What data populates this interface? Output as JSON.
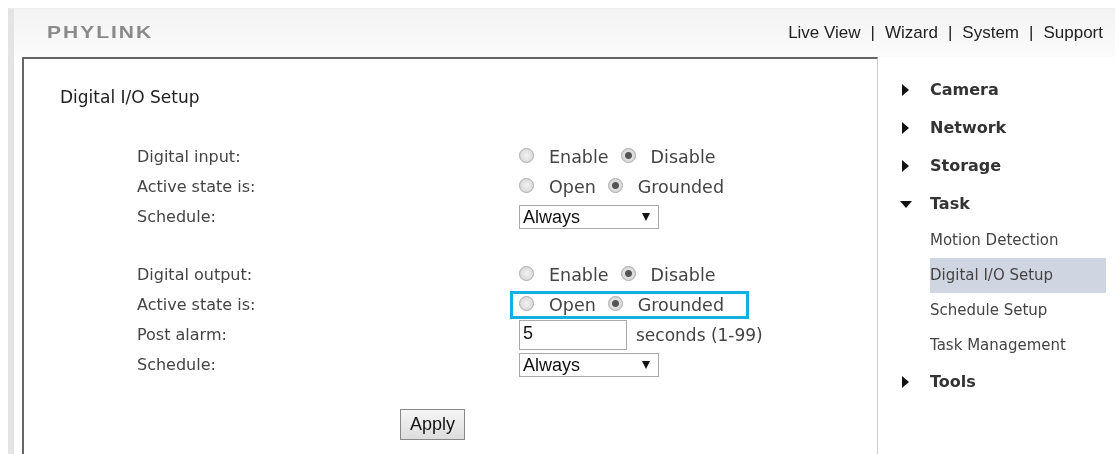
{
  "header": {
    "logo": "PHYLINK",
    "separator": "|",
    "nav": [
      {
        "label": "Live View"
      },
      {
        "label": "Wizard"
      },
      {
        "label": "System"
      },
      {
        "label": "Support"
      }
    ]
  },
  "panel": {
    "title": "Digital I/O Setup",
    "groups": [
      {
        "rows": [
          {
            "kind": "radio",
            "label": "Digital input:",
            "highlighted": false,
            "options": [
              {
                "label": "Enable",
                "selected": false
              },
              {
                "label": "Disable",
                "selected": true
              }
            ]
          },
          {
            "kind": "radio",
            "label": "Active state is:",
            "highlighted": false,
            "options": [
              {
                "label": "Open",
                "selected": false
              },
              {
                "label": "Grounded",
                "selected": true
              }
            ]
          },
          {
            "kind": "select",
            "label": "Schedule:",
            "value": "Always"
          }
        ]
      },
      {
        "rows": [
          {
            "kind": "radio",
            "label": "Digital output:",
            "highlighted": false,
            "options": [
              {
                "label": "Enable",
                "selected": false
              },
              {
                "label": "Disable",
                "selected": true
              }
            ]
          },
          {
            "kind": "radio",
            "label": "Active state is:",
            "highlighted": true,
            "options": [
              {
                "label": "Open",
                "selected": false
              },
              {
                "label": "Grounded",
                "selected": true
              }
            ]
          },
          {
            "kind": "number",
            "label": "Post alarm:",
            "value": "5",
            "suffix": "seconds (1-99)"
          },
          {
            "kind": "select",
            "label": "Schedule:",
            "value": "Always"
          }
        ]
      }
    ],
    "apply_button": "Apply"
  },
  "sidebar": {
    "items": [
      {
        "label": "Camera",
        "expanded": false
      },
      {
        "label": "Network",
        "expanded": false
      },
      {
        "label": "Storage",
        "expanded": false
      },
      {
        "label": "Task",
        "expanded": true,
        "children": [
          {
            "label": "Motion Detection",
            "selected": false
          },
          {
            "label": "Digital I/O Setup",
            "selected": true
          },
          {
            "label": "Schedule Setup",
            "selected": false
          },
          {
            "label": "Task Management",
            "selected": false
          }
        ]
      },
      {
        "label": "Tools",
        "expanded": false
      }
    ]
  }
}
